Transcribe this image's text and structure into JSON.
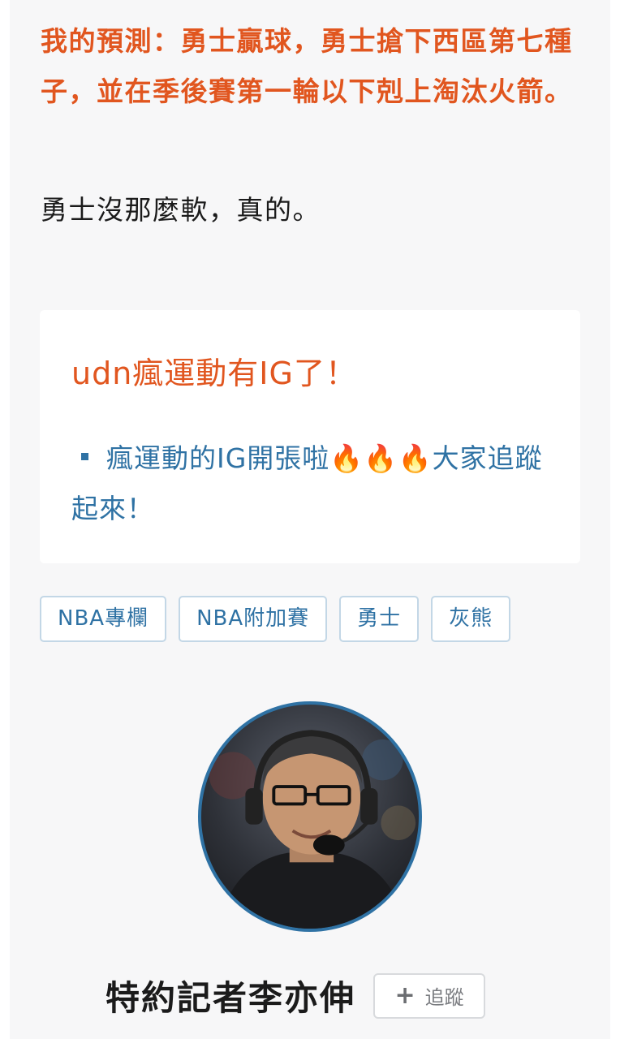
{
  "article": {
    "prediction": "我的預測：勇士贏球，勇士搶下西區第七種子，並在季後賽第一輪以下剋上淘汰火箭。",
    "remark": "勇士沒那麼軟，真的。"
  },
  "promo": {
    "title": "udn瘋運動有IG了！",
    "link_text": "瘋運動的IG開張啦🔥🔥🔥大家追蹤起來！"
  },
  "tags": [
    "NBA專欄",
    "NBA附加賽",
    "勇士",
    "灰熊"
  ],
  "author": {
    "name": "特約記者李亦伸",
    "follow_label": "追蹤",
    "follow_icon": "plus-icon"
  },
  "colors": {
    "accent_orange": "#e1561f",
    "link_blue": "#2f72a4",
    "text_dark": "#1b1b1b",
    "background": "#f7f7f8"
  }
}
